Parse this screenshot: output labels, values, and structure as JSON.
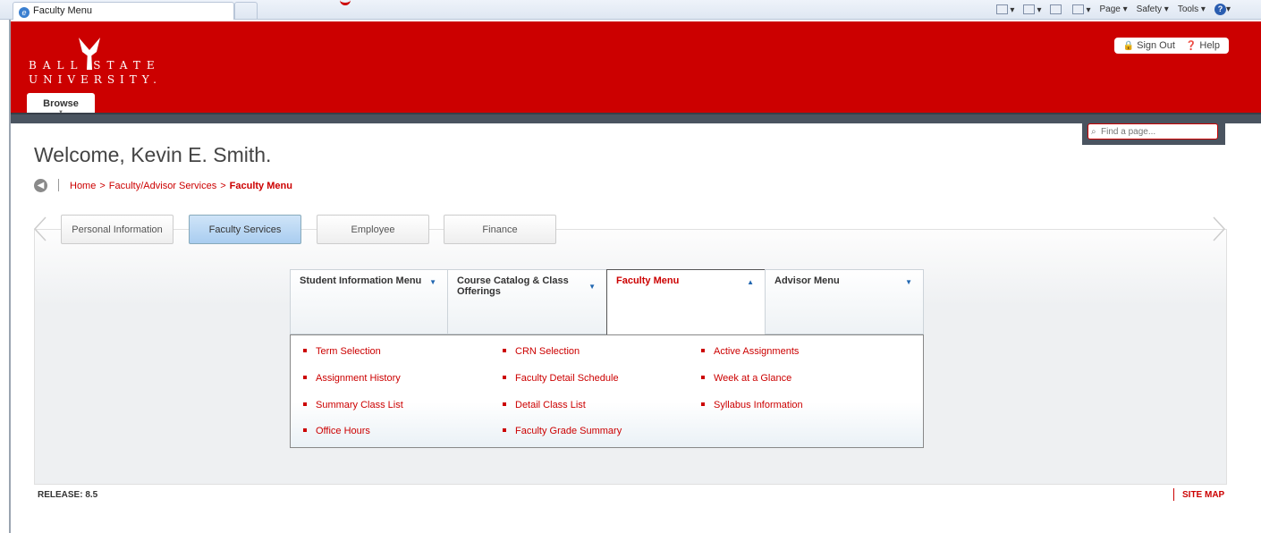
{
  "browser": {
    "tab_title": "Faculty Menu",
    "toolbar": {
      "page": "Page ▾",
      "safety": "Safety ▾",
      "tools": "Tools ▾",
      "help_glyph": "?"
    }
  },
  "header": {
    "logo_line1": "BALL  STATE",
    "logo_line2": "UNIVERSITY.",
    "browse_label": "Browse",
    "sign_out": "Sign Out",
    "help": "Help",
    "find_placeholder": "Find a page..."
  },
  "welcome": "Welcome, Kevin E. Smith.",
  "breadcrumb": {
    "home": "Home",
    "parent": "Faculty/Advisor Services",
    "current": "Faculty Menu"
  },
  "tabs": [
    "Personal Information",
    "Faculty Services",
    "Employee",
    "Finance"
  ],
  "active_tab": "Faculty Services",
  "menus": [
    {
      "label": "Student Information Menu",
      "state": "collapsed"
    },
    {
      "label": "Course Catalog & Class Offerings",
      "state": "collapsed"
    },
    {
      "label": "Faculty Menu",
      "state": "expanded"
    },
    {
      "label": "Advisor Menu",
      "state": "collapsed"
    }
  ],
  "faculty_menu_items": {
    "col1": [
      "Term Selection",
      "Assignment History",
      "Summary Class List",
      "Office Hours"
    ],
    "col2": [
      "CRN Selection",
      "Faculty Detail Schedule",
      "Detail Class List",
      "Faculty Grade Summary"
    ],
    "col3": [
      "Active Assignments",
      "Week at a Glance",
      "Syllabus Information"
    ]
  },
  "footer": {
    "release": "RELEASE: 8.5",
    "site_map": "SITE MAP"
  },
  "colors": {
    "brand_red": "#cc0000",
    "dark_bar": "#4a5460",
    "active_tab": "#a9cdf0"
  }
}
